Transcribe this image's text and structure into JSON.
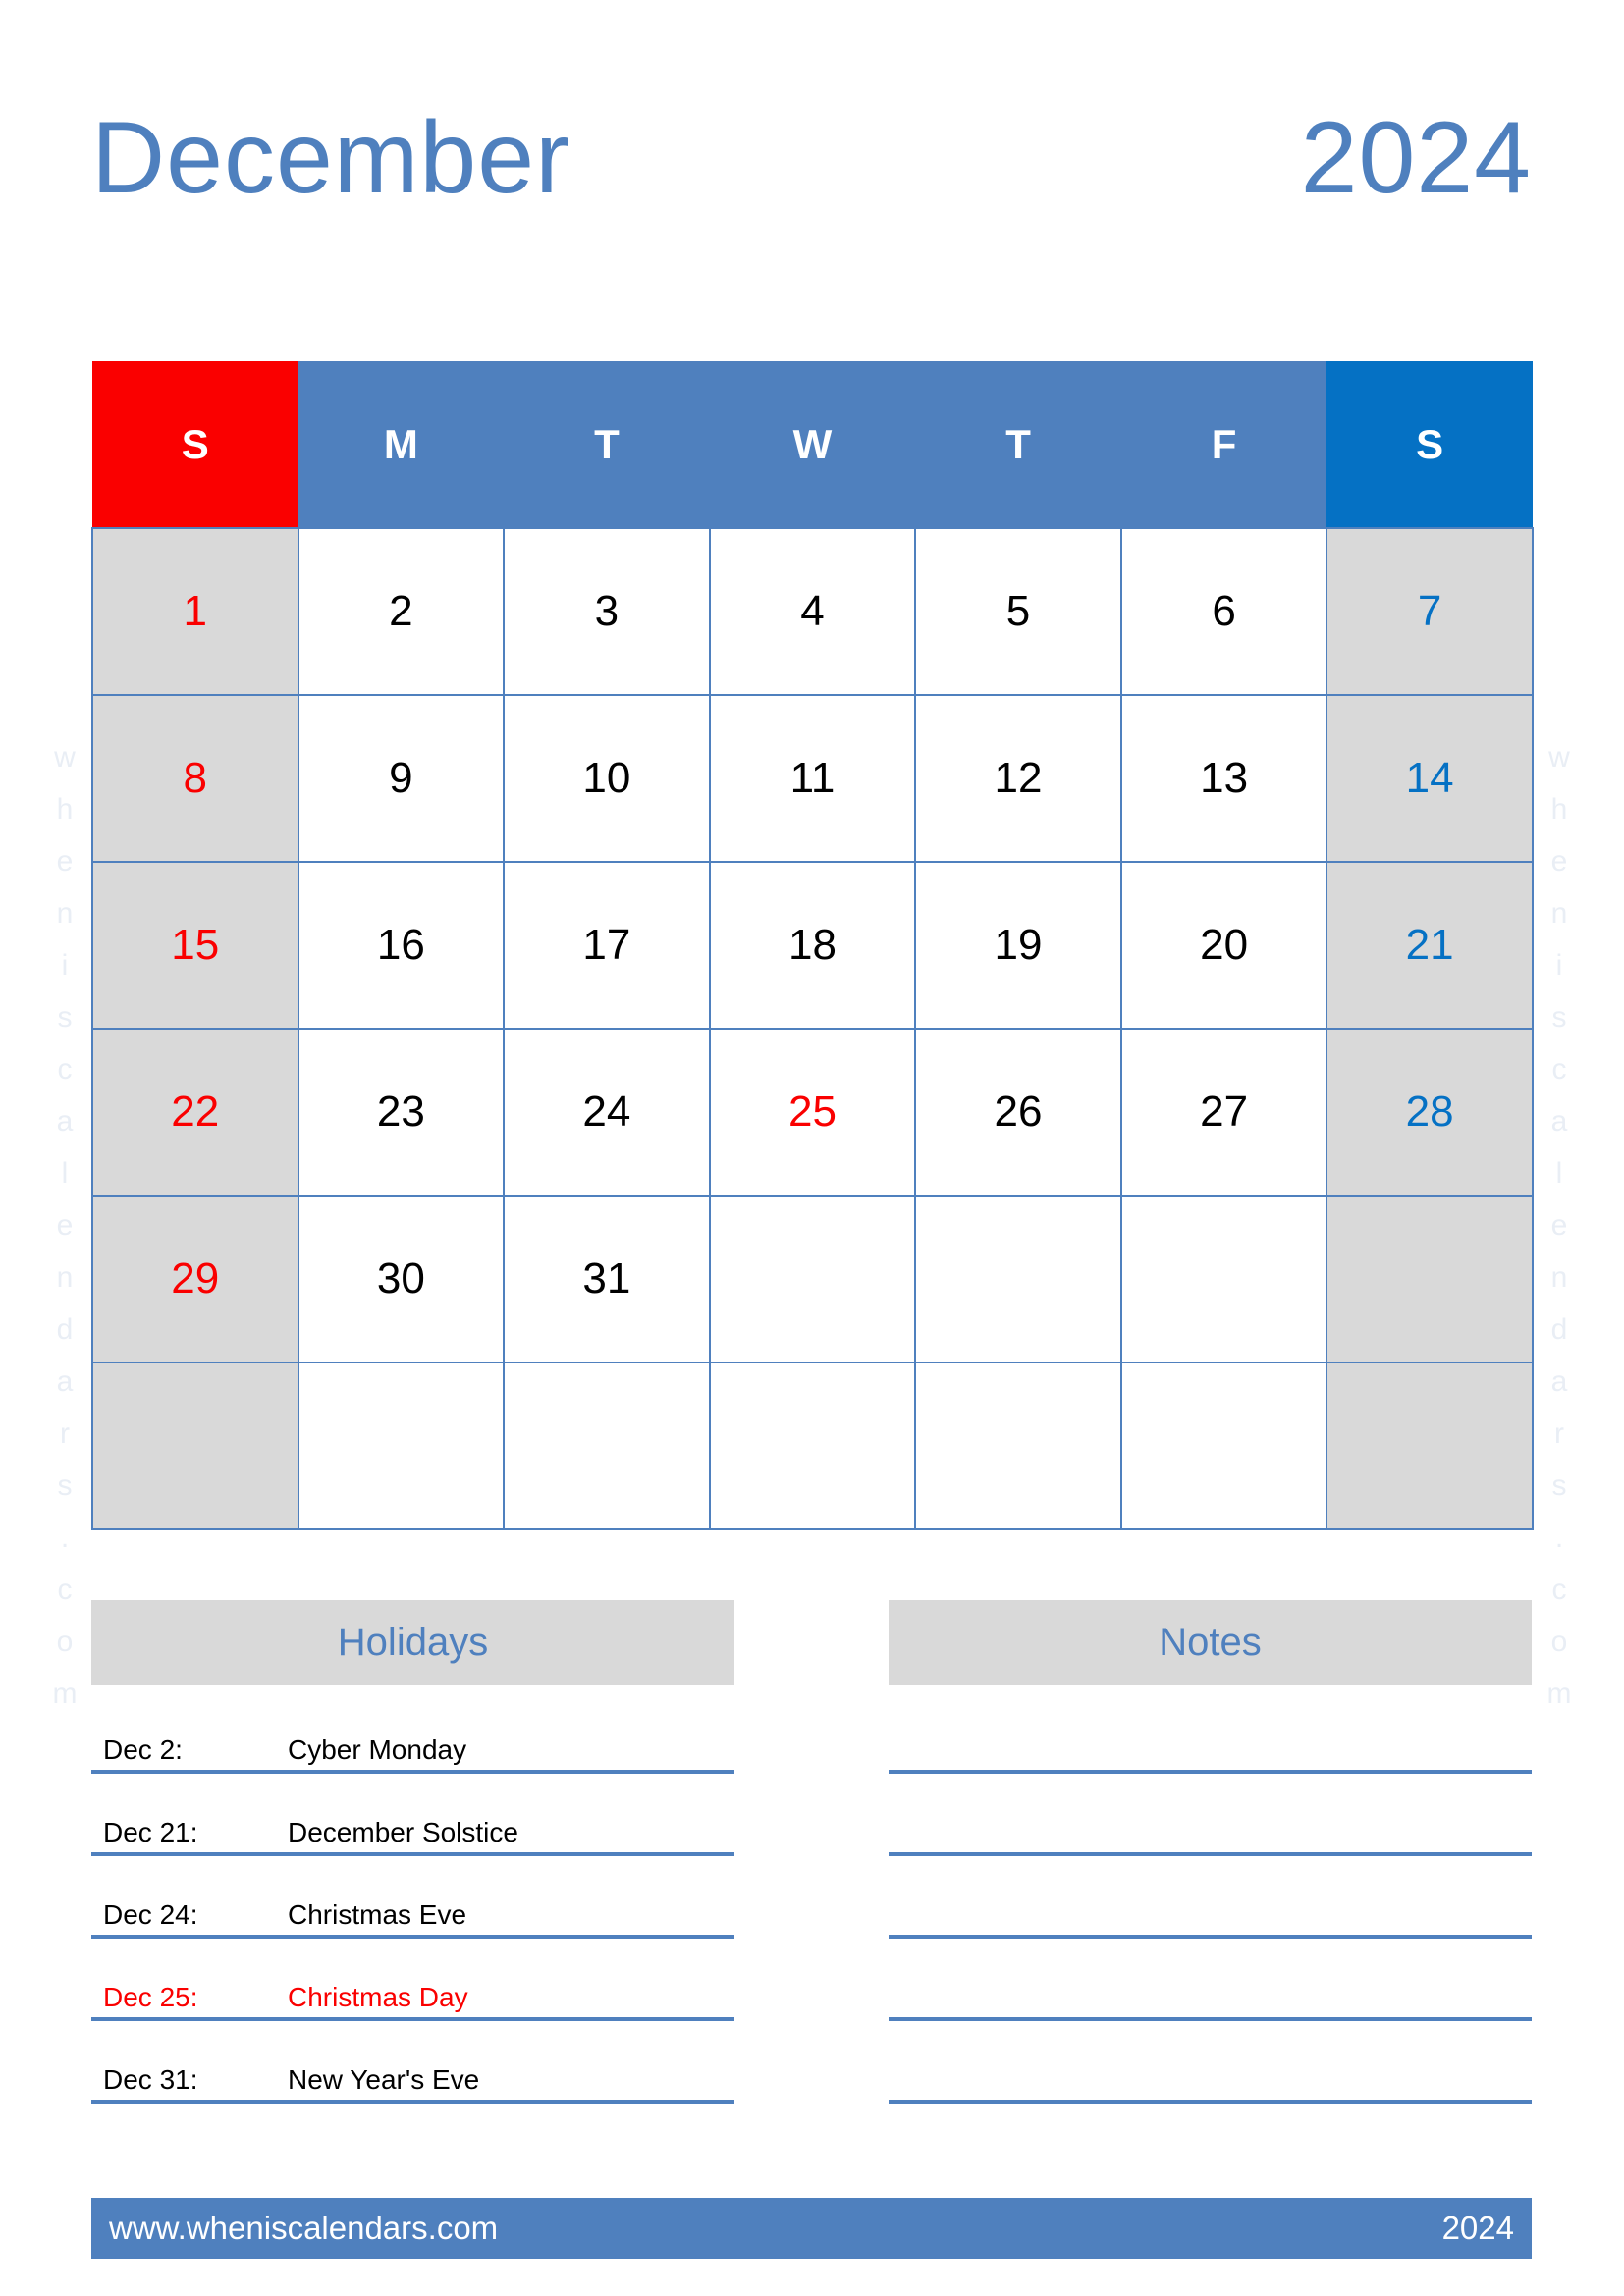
{
  "title": {
    "month": "December",
    "year": "2024"
  },
  "colors": {
    "header_blue": "#4f80be",
    "saturday_blue": "#0571c4",
    "sunday_red": "#fa0000",
    "weekend_gray": "#d9d9d9",
    "panel_gray": "#d9d9d9",
    "text_black": "#000000",
    "watermark": "#e9eef5"
  },
  "watermark": {
    "text": "wheniscalendars.com"
  },
  "weekdays": [
    {
      "label": "S",
      "name": "sunday"
    },
    {
      "label": "M",
      "name": "monday"
    },
    {
      "label": "T",
      "name": "tuesday"
    },
    {
      "label": "W",
      "name": "wednesday"
    },
    {
      "label": "T",
      "name": "thursday"
    },
    {
      "label": "F",
      "name": "friday"
    },
    {
      "label": "S",
      "name": "saturday"
    }
  ],
  "weeks": [
    [
      {
        "d": "1",
        "style": "sun"
      },
      {
        "d": "2",
        "style": ""
      },
      {
        "d": "3",
        "style": ""
      },
      {
        "d": "4",
        "style": ""
      },
      {
        "d": "5",
        "style": ""
      },
      {
        "d": "6",
        "style": ""
      },
      {
        "d": "7",
        "style": "sat"
      }
    ],
    [
      {
        "d": "8",
        "style": "sun"
      },
      {
        "d": "9",
        "style": ""
      },
      {
        "d": "10",
        "style": ""
      },
      {
        "d": "11",
        "style": ""
      },
      {
        "d": "12",
        "style": ""
      },
      {
        "d": "13",
        "style": ""
      },
      {
        "d": "14",
        "style": "sat"
      }
    ],
    [
      {
        "d": "15",
        "style": "sun"
      },
      {
        "d": "16",
        "style": ""
      },
      {
        "d": "17",
        "style": ""
      },
      {
        "d": "18",
        "style": ""
      },
      {
        "d": "19",
        "style": ""
      },
      {
        "d": "20",
        "style": ""
      },
      {
        "d": "21",
        "style": "sat"
      }
    ],
    [
      {
        "d": "22",
        "style": "sun"
      },
      {
        "d": "23",
        "style": ""
      },
      {
        "d": "24",
        "style": ""
      },
      {
        "d": "25",
        "style": "holiday"
      },
      {
        "d": "26",
        "style": ""
      },
      {
        "d": "27",
        "style": ""
      },
      {
        "d": "28",
        "style": "sat"
      }
    ],
    [
      {
        "d": "29",
        "style": "sun"
      },
      {
        "d": "30",
        "style": ""
      },
      {
        "d": "31",
        "style": ""
      },
      {
        "d": "",
        "style": ""
      },
      {
        "d": "",
        "style": ""
      },
      {
        "d": "",
        "style": ""
      },
      {
        "d": "",
        "style": "sat"
      }
    ],
    [
      {
        "d": "",
        "style": "sun"
      },
      {
        "d": "",
        "style": ""
      },
      {
        "d": "",
        "style": ""
      },
      {
        "d": "",
        "style": ""
      },
      {
        "d": "",
        "style": ""
      },
      {
        "d": "",
        "style": ""
      },
      {
        "d": "",
        "style": "sat"
      }
    ]
  ],
  "holidays_panel": {
    "heading": "Holidays",
    "rows": [
      {
        "date": "Dec 2:",
        "name": "Cyber Monday",
        "highlight": false
      },
      {
        "date": "Dec 21:",
        "name": "December Solstice",
        "highlight": false
      },
      {
        "date": "Dec 24:",
        "name": "Christmas Eve",
        "highlight": false
      },
      {
        "date": "Dec 25:",
        "name": "Christmas Day",
        "highlight": true
      },
      {
        "date": "Dec 31:",
        "name": "New Year's Eve",
        "highlight": false
      }
    ]
  },
  "notes_panel": {
    "heading": "Notes",
    "line_count": 5
  },
  "footer": {
    "url": "www.wheniscalendars.com",
    "year": "2024"
  }
}
